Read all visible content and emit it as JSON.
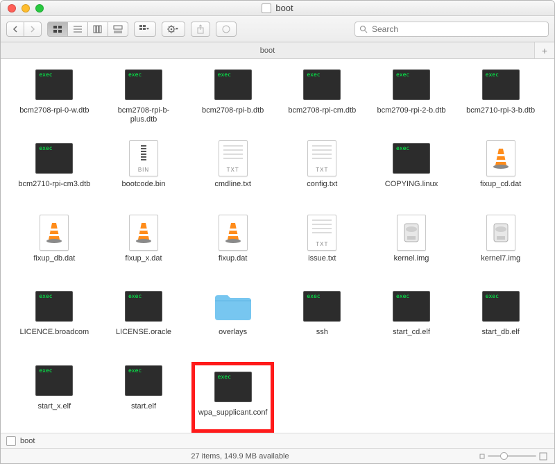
{
  "window": {
    "title": "boot"
  },
  "toolbar": {
    "search_placeholder": "Search"
  },
  "tabbar": {
    "tab_label": "boot"
  },
  "pathbar": {
    "label": "boot"
  },
  "status": {
    "text": "27 items, 149.9 MB available"
  },
  "items": [
    {
      "name": "bcm2708-rpi-0-w.dtb",
      "kind": "exec"
    },
    {
      "name": "bcm2708-rpi-b-plus.dtb",
      "kind": "exec"
    },
    {
      "name": "bcm2708-rpi-b.dtb",
      "kind": "exec"
    },
    {
      "name": "bcm2708-rpi-cm.dtb",
      "kind": "exec"
    },
    {
      "name": "bcm2709-rpi-2-b.dtb",
      "kind": "exec"
    },
    {
      "name": "bcm2710-rpi-3-b.dtb",
      "kind": "exec"
    },
    {
      "name": "bcm2710-rpi-cm3.dtb",
      "kind": "exec"
    },
    {
      "name": "bootcode.bin",
      "kind": "bin"
    },
    {
      "name": "cmdline.txt",
      "kind": "txt"
    },
    {
      "name": "config.txt",
      "kind": "txt"
    },
    {
      "name": "COPYING.linux",
      "kind": "exec"
    },
    {
      "name": "fixup_cd.dat",
      "kind": "vlc"
    },
    {
      "name": "fixup_db.dat",
      "kind": "vlc"
    },
    {
      "name": "fixup_x.dat",
      "kind": "vlc"
    },
    {
      "name": "fixup.dat",
      "kind": "vlc"
    },
    {
      "name": "issue.txt",
      "kind": "txt"
    },
    {
      "name": "kernel.img",
      "kind": "img"
    },
    {
      "name": "kernel7.img",
      "kind": "img"
    },
    {
      "name": "LICENCE.broadcom",
      "kind": "exec"
    },
    {
      "name": "LICENSE.oracle",
      "kind": "exec"
    },
    {
      "name": "overlays",
      "kind": "folder"
    },
    {
      "name": "ssh",
      "kind": "exec"
    },
    {
      "name": "start_cd.elf",
      "kind": "exec"
    },
    {
      "name": "start_db.elf",
      "kind": "exec"
    },
    {
      "name": "start_x.elf",
      "kind": "exec"
    },
    {
      "name": "start.elf",
      "kind": "exec"
    },
    {
      "name": "wpa_supplicant.conf",
      "kind": "exec",
      "highlight": true
    }
  ]
}
